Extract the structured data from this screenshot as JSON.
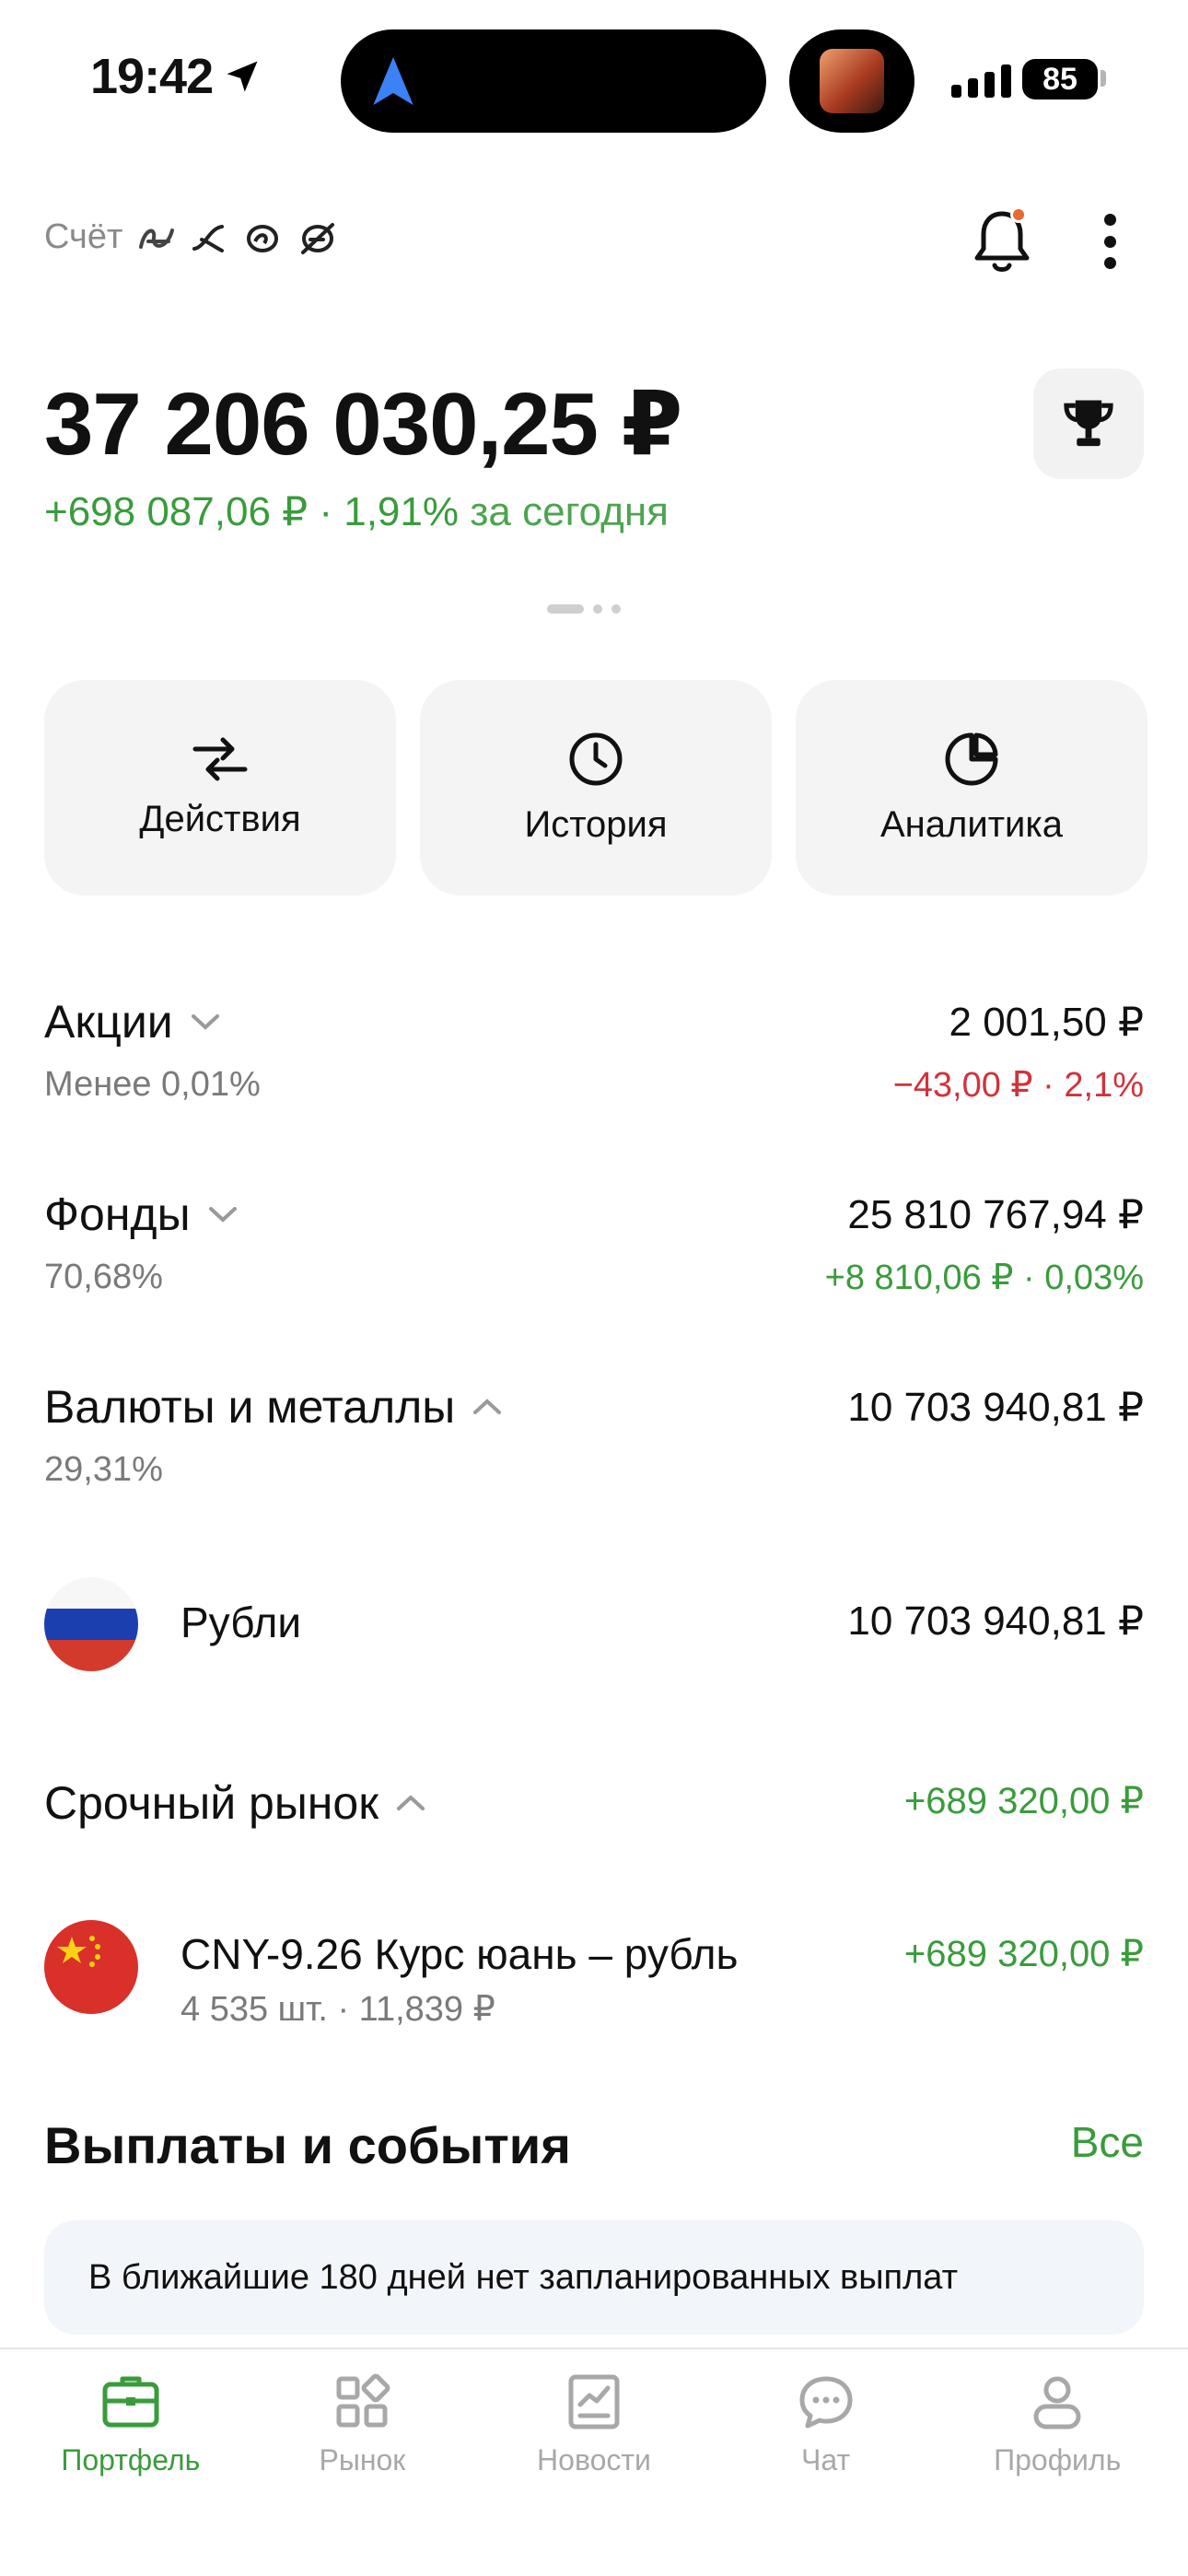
{
  "status_bar": {
    "time": "19:42",
    "battery": "85"
  },
  "header": {
    "account_label": "Счёт",
    "account_name_obfuscated": "ꭍ𝜘 ꙆꝾꝊ"
  },
  "balance": {
    "total": "37 206 030,25 ₽",
    "change_value": "+698 087,06 ₽ · 1,91%",
    "change_period": "за сегодня"
  },
  "actions": [
    {
      "label": "Действия",
      "icon": "transfer-arrows-icon"
    },
    {
      "label": "История",
      "icon": "clock-icon"
    },
    {
      "label": "Аналитика",
      "icon": "pie-chart-icon"
    }
  ],
  "sections": {
    "stocks": {
      "title": "Акции",
      "share": "Менее 0,01%",
      "value": "2 001,50 ₽",
      "change": "−43,00 ₽ · 2,1%"
    },
    "funds": {
      "title": "Фонды",
      "share": "70,68%",
      "value": "25 810 767,94 ₽",
      "change": "+8 810,06 ₽ · 0,03%"
    },
    "currencies": {
      "title": "Валюты и металлы",
      "share": "29,31%",
      "value": "10 703 940,81 ₽"
    },
    "rubles": {
      "name": "Рубли",
      "value": "10 703 940,81 ₽"
    },
    "futures": {
      "title": "Срочный рынок",
      "value": "+689 320,00 ₽"
    },
    "cny": {
      "name": "CNY-9.26 Курс юань – рубль",
      "sub": "4 535 шт. · 11,839 ₽",
      "value": "+689 320,00 ₽"
    }
  },
  "events": {
    "title": "Выплаты и события",
    "all_label": "Все",
    "notice": "В ближайшие 180 дней нет запланированных выплат"
  },
  "tabbar": [
    {
      "label": "Портфель",
      "icon": "briefcase-icon",
      "active": true
    },
    {
      "label": "Рынок",
      "icon": "grid-icon",
      "active": false
    },
    {
      "label": "Новости",
      "icon": "news-chart-icon",
      "active": false
    },
    {
      "label": "Чат",
      "icon": "chat-icon",
      "active": false
    },
    {
      "label": "Профиль",
      "icon": "person-icon",
      "active": false
    }
  ],
  "colors": {
    "green": "#3a9b3c",
    "red": "#d2323c",
    "gray_text": "#7a7a7a",
    "card_bg": "#f4f4f4"
  }
}
